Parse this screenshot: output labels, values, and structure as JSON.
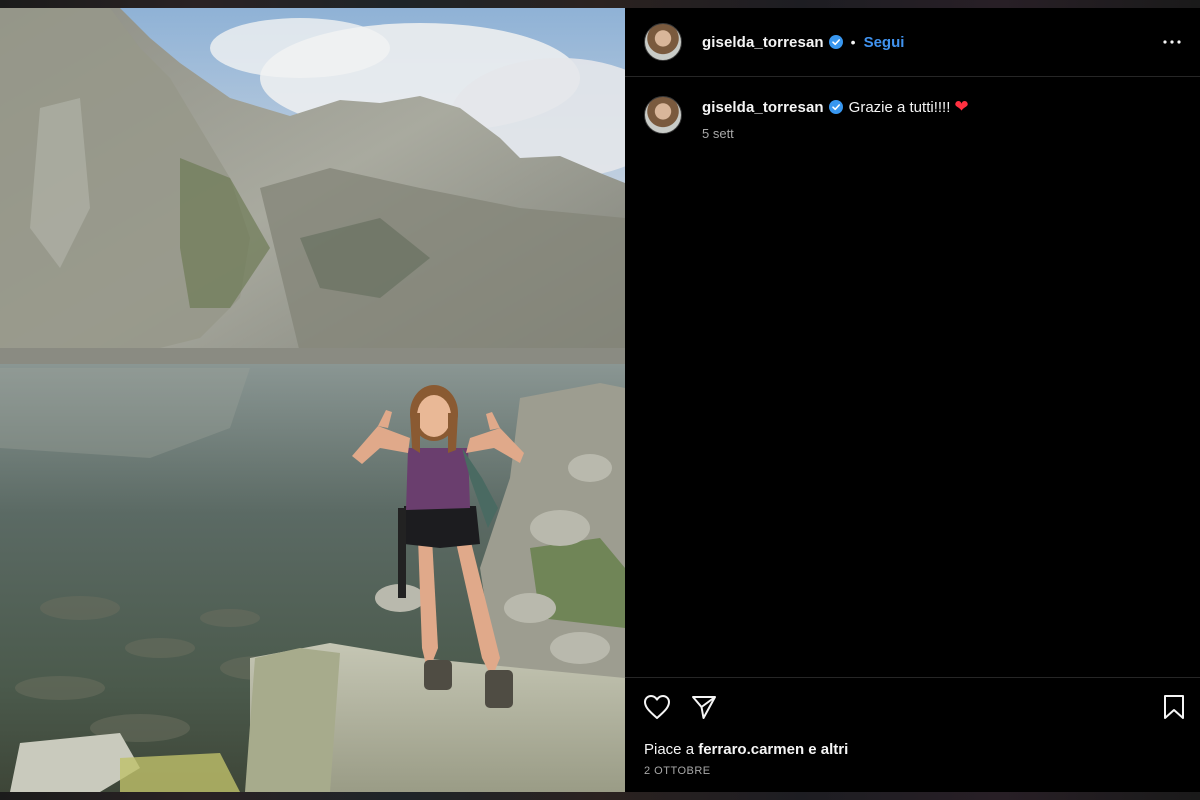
{
  "post": {
    "author": {
      "username": "giselda_torresan",
      "verified": true,
      "follow_label": "Segui"
    },
    "caption": {
      "text": "Grazie a tutti!!!!",
      "emoji": "❤",
      "time": "5 sett"
    },
    "likes": {
      "prefix": "Piace a",
      "user": "ferraro.carmen",
      "suffix": "e altri"
    },
    "date": "2 OTTOBRE"
  },
  "icons": {
    "more": "more-horizontal-icon",
    "like": "heart-outline-icon",
    "share": "paper-plane-icon",
    "save": "bookmark-icon",
    "verified": "verified-badge-icon"
  },
  "colors": {
    "background": "#000000",
    "accent": "#4193ef",
    "text": "#f5f5f5",
    "muted": "#a8a8a8",
    "divider": "#262626",
    "verified": "#3897f0",
    "heart_emoji": "#ff3040"
  }
}
